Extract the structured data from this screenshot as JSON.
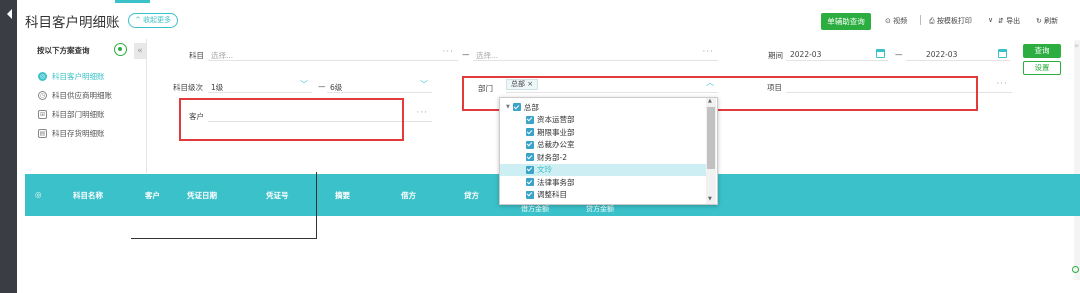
{
  "page": {
    "title": "科目客户明细账",
    "collapse_label": "收起更多"
  },
  "toolbar": {
    "assist_query": "单辅助查询",
    "video": "视频",
    "print": "按模板打印",
    "export": "导出",
    "refresh": "刷新"
  },
  "left_panel": {
    "heading": "按以下方案查询",
    "items": [
      {
        "label": "科目客户明细账",
        "icon": "target-icon",
        "active": true
      },
      {
        "label": "科目供应商明细账",
        "icon": "clock-icon",
        "active": false
      },
      {
        "label": "科目部门明细账",
        "icon": "org-icon",
        "active": false
      },
      {
        "label": "科目存货明细账",
        "icon": "box-icon",
        "active": false
      }
    ]
  },
  "filters": {
    "subject_label": "科目",
    "subject_from_placeholder": "选择...",
    "range_dash": "—",
    "subject_to_placeholder": "选择...",
    "period_label": "期间",
    "period_from": "2022-03",
    "period_to": "2022-03",
    "level_label": "科目级次",
    "level_from": "1级",
    "level_to": "6级",
    "dept_label": "部门",
    "dept_tag": "总部",
    "project_label": "项目",
    "customer_label": "客户",
    "query_button": "查询",
    "settings_button": "设置"
  },
  "table": {
    "headers": [
      "科目名称",
      "客户",
      "凭证日期",
      "凭证号",
      "摘要",
      "借方",
      "贷方"
    ],
    "subheaders": [
      "借方金额",
      "贷方金额"
    ]
  },
  "dept_dropdown": {
    "root": "总部",
    "items": [
      "资本运营部",
      "期限事业部",
      "总裁办公室",
      "财务部-2",
      "文玲",
      "法律事务部",
      "调整科目"
    ],
    "highlighted_index": 4
  },
  "colors": {
    "accent": "#3bc1c9",
    "green": "#2bae3f",
    "red": "#e23b3b",
    "checkbox": "#3aa3c8"
  }
}
